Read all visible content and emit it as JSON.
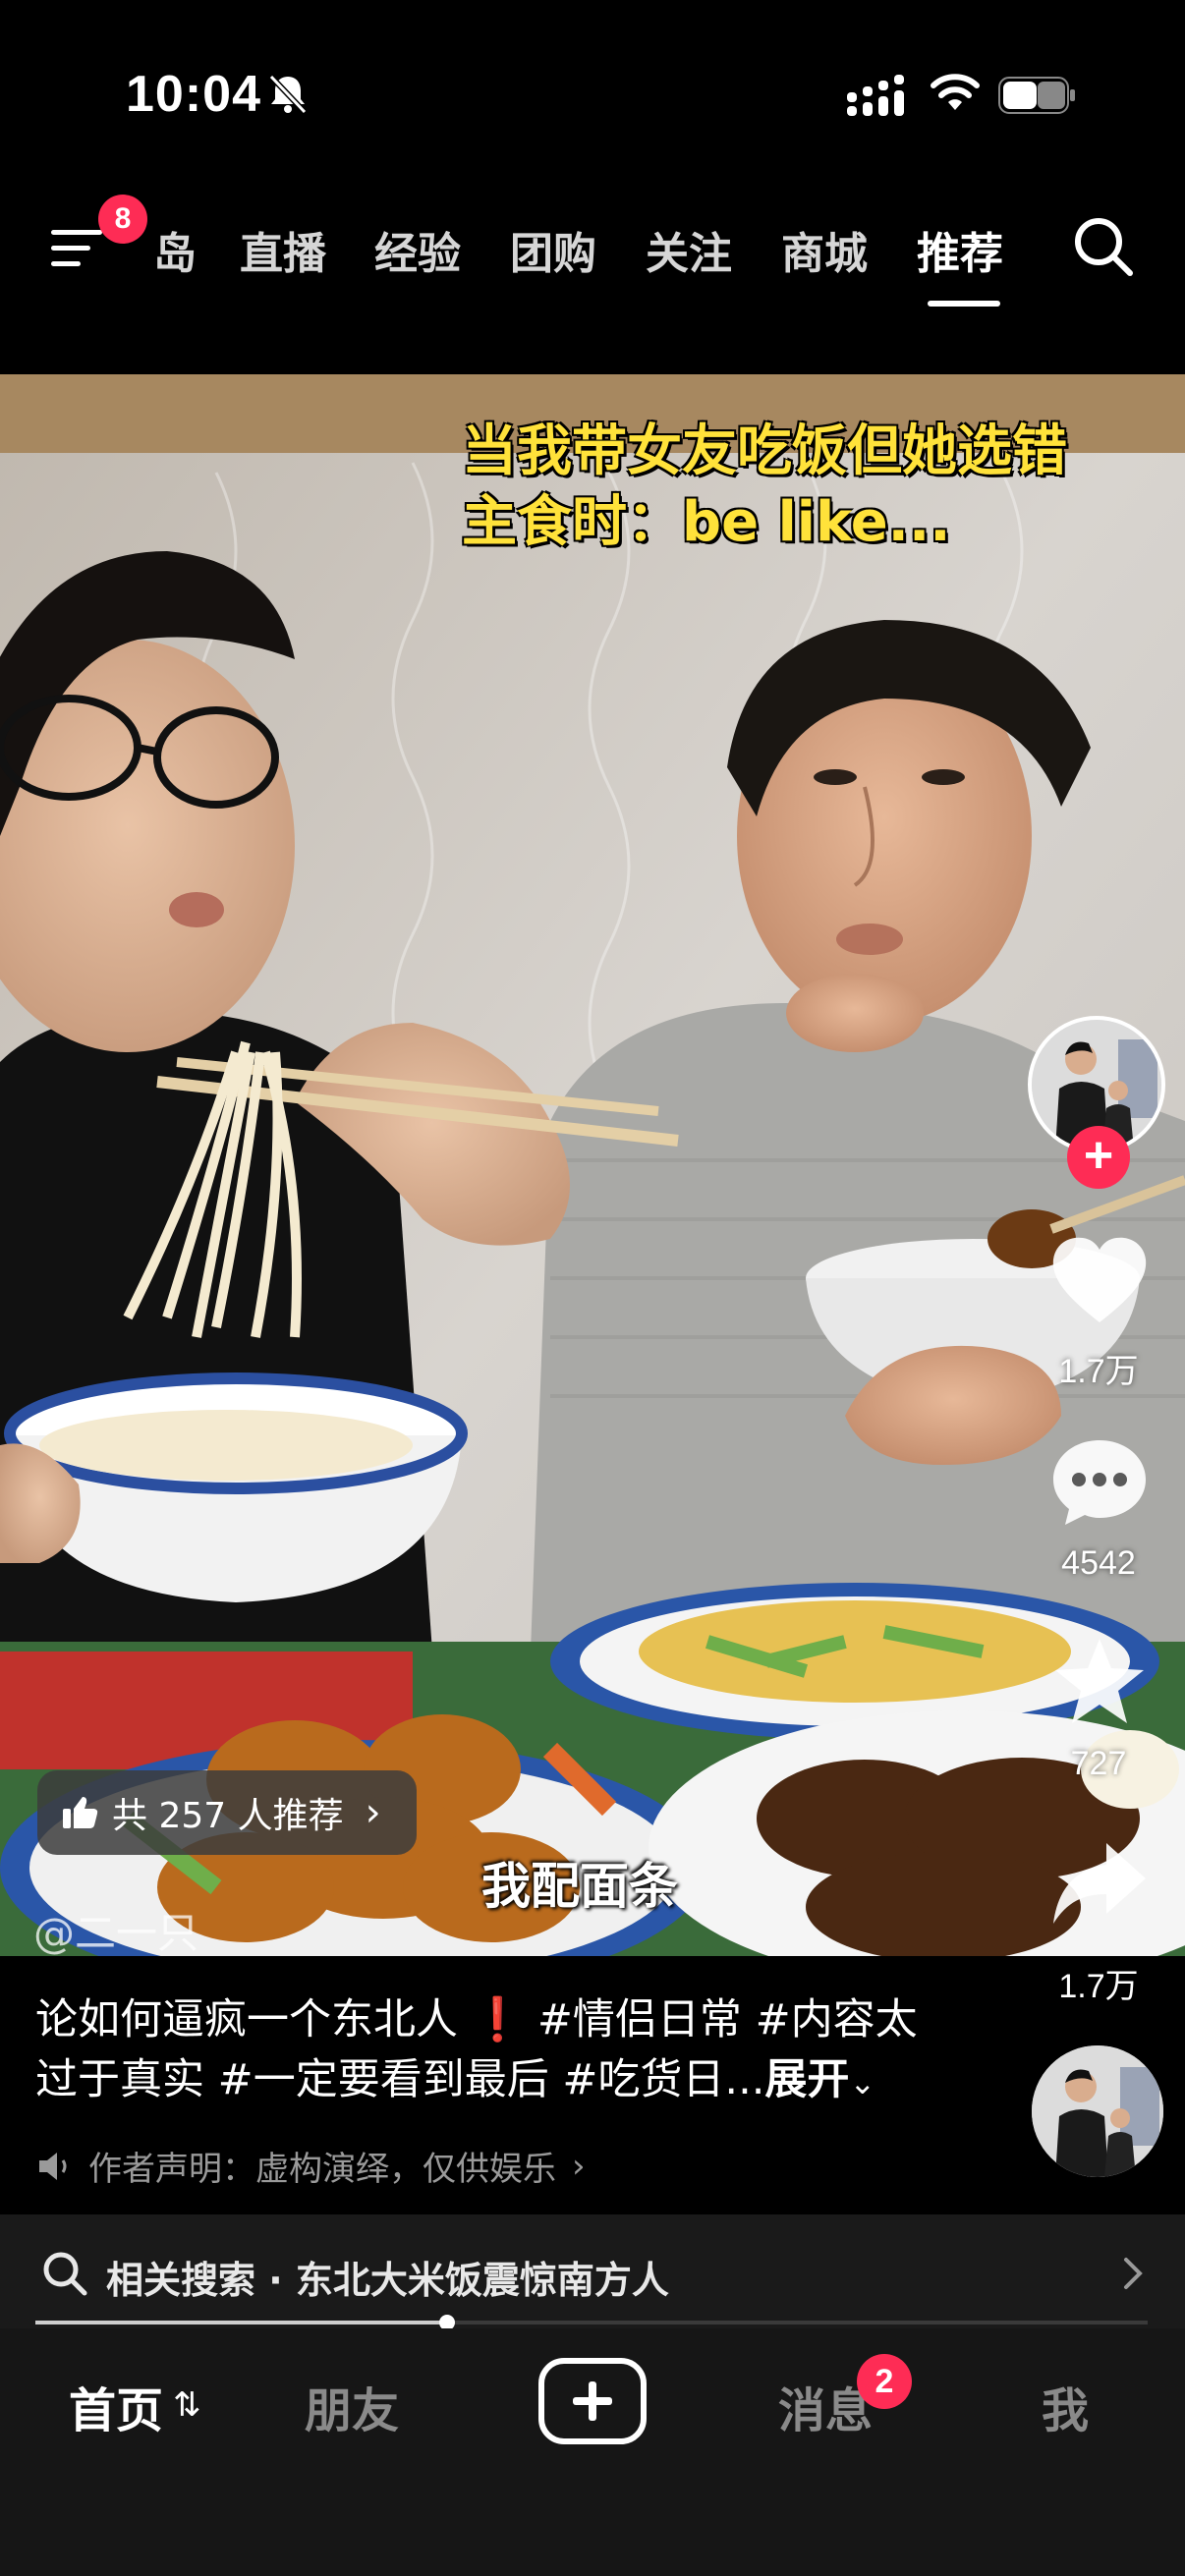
{
  "status_bar": {
    "time": "10:04"
  },
  "top_nav": {
    "menu_badge": "8",
    "tabs": [
      {
        "label": "岛"
      },
      {
        "label": "直播"
      },
      {
        "label": "经验"
      },
      {
        "label": "团购"
      },
      {
        "label": "关注"
      },
      {
        "label": "商城"
      },
      {
        "label": "推荐",
        "active": true
      }
    ]
  },
  "video": {
    "overlay_title_line1": "当我带女友吃饭但她选错",
    "overlay_title_line2": "主食时：be like...",
    "subtitle": "我配面条",
    "recommend_pill": "共 257 人推荐",
    "author_handle": "@二一只"
  },
  "right_rail": {
    "like_count": "1.7万",
    "comment_count": "4542",
    "favorite_count": "727",
    "share_count": "1.7万"
  },
  "description": {
    "text": "论如何逼疯一个东北人",
    "tags": [
      "#情侣日常",
      "#内容太过于真实",
      "#一定要看到最后",
      "#吃货日..."
    ],
    "tag_1": "#情侣日常",
    "tag_2_part1": "#内容太",
    "tag_2_part2": "过于真实",
    "tag_3": "#一定要看到最后",
    "tag_4": "#吃货日...",
    "expand_label": "展开",
    "disclaimer": "作者声明：虚构演绎，仅供娱乐"
  },
  "related_search": {
    "label": "相关搜索 · 东北大米饭震惊南方人"
  },
  "progress": {
    "fraction": 0.37
  },
  "bottom_nav": {
    "home": "首页",
    "friends": "朋友",
    "messages": "消息",
    "messages_badge": "2",
    "me": "我"
  },
  "colors": {
    "accent": "#fe2c55",
    "overlay_text": "#ffe23a",
    "background": "#000000"
  }
}
